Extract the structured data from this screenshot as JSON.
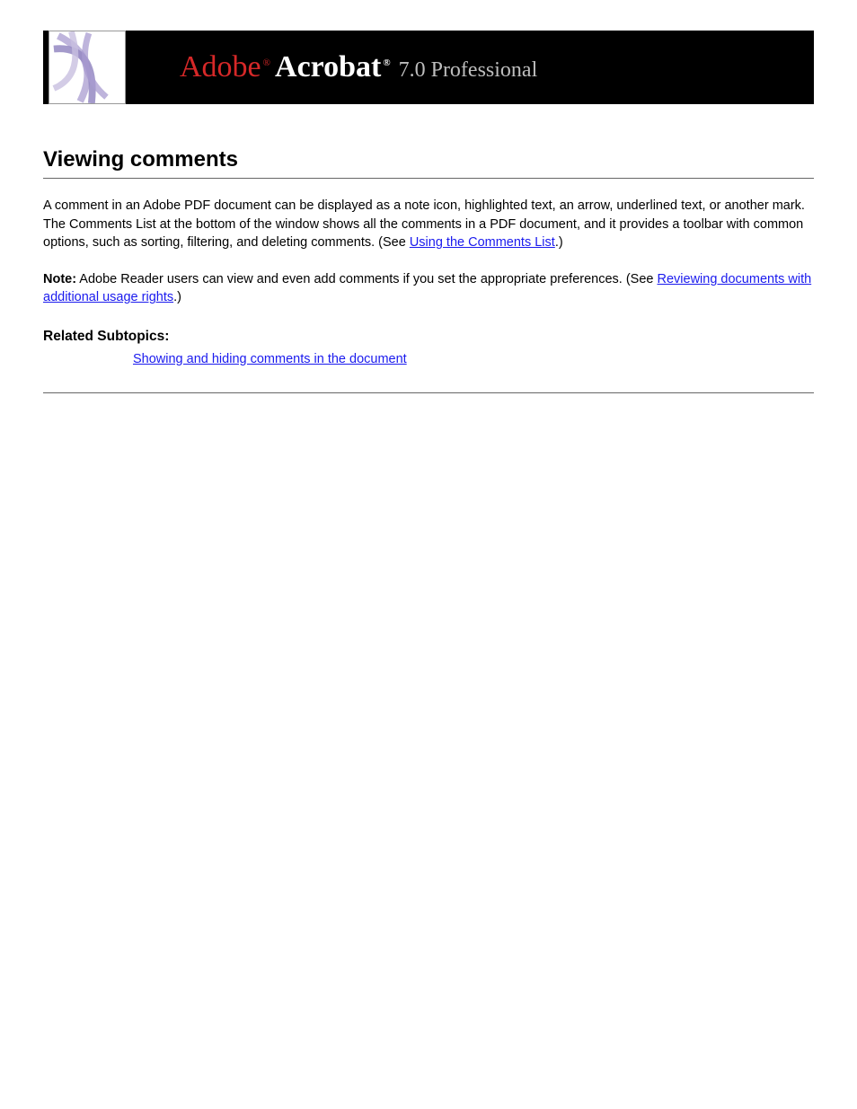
{
  "banner": {
    "adobe": "Adobe",
    "reg": "®",
    "acrobat": "Acrobat",
    "version": "7.0 Professional"
  },
  "section1": {
    "title": "Viewing comments",
    "paragraph_before_link1": "A comment in an Adobe PDF document can be displayed as a note icon, highlighted text, an arrow, underlined text, or another mark. The Comments List at the bottom of the window shows all the comments in a PDF document, and it provides a toolbar with common options, such as sorting, filtering, and deleting comments. (See ",
    "link1": "Using the Comments List",
    "paragraph_after_link1": ".)",
    "note_label": "Note:",
    "note_text_before_link": " Adobe Reader users can view and even add comments if you set the appropriate preferences. (See ",
    "link2": "Reviewing documents with additional usage rights",
    "note_text_after_link": ".)"
  },
  "related": {
    "title": "Related Subtopics:",
    "link": "Showing and hiding comments in the document"
  }
}
